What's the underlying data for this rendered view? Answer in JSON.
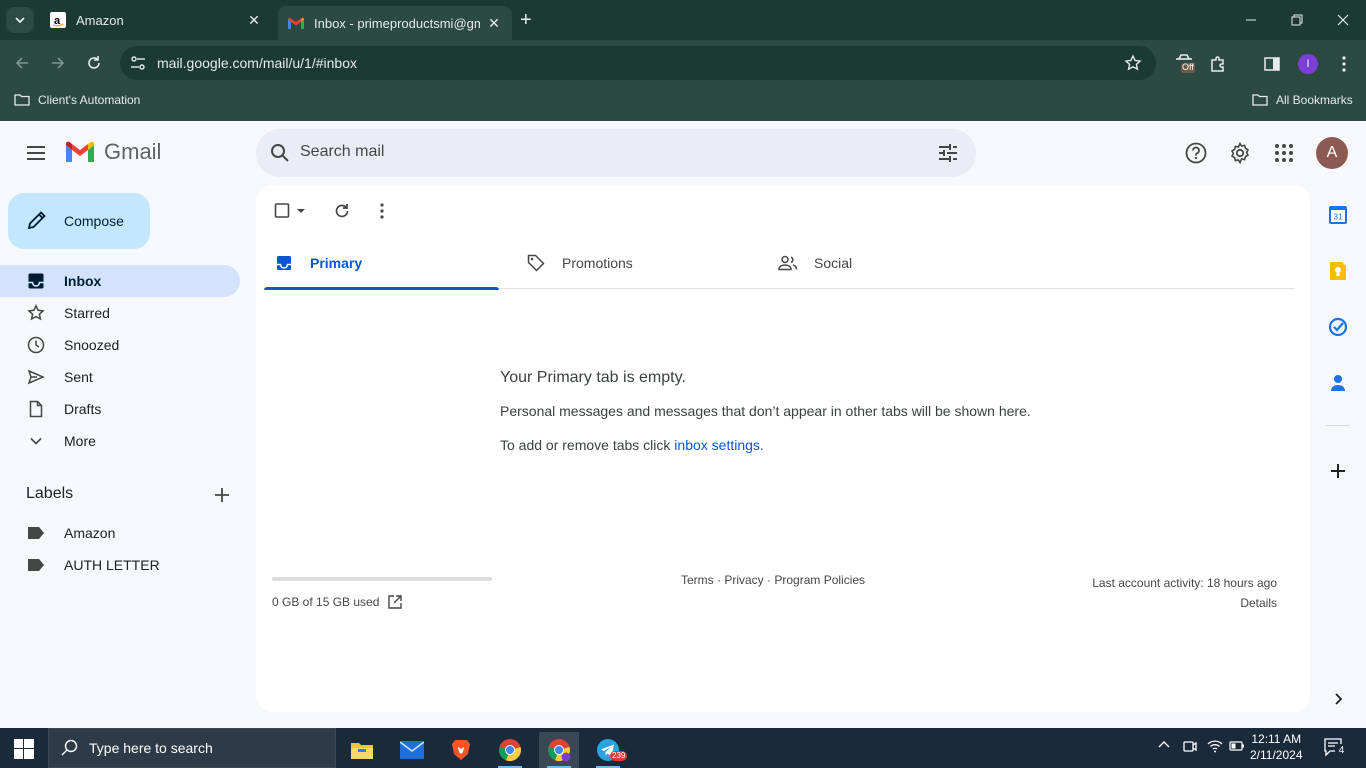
{
  "browser": {
    "tabs": [
      {
        "title": "Amazon",
        "active": false
      },
      {
        "title": "Inbox - primeproductsmi@gma",
        "active": true
      }
    ],
    "url": "mail.google.com/mail/u/1/#inbox",
    "extension_badge": "Off",
    "profile_initial": "I",
    "bookmarks": {
      "folder": "Client's Automation",
      "all": "All Bookmarks"
    }
  },
  "gmail": {
    "logo_text": "Gmail",
    "search_placeholder": "Search mail",
    "avatar_initial": "A",
    "compose_label": "Compose",
    "nav": [
      {
        "label": "Inbox",
        "icon": "inbox-icon",
        "active": true
      },
      {
        "label": "Starred",
        "icon": "star-icon",
        "active": false
      },
      {
        "label": "Snoozed",
        "icon": "clock-icon",
        "active": false
      },
      {
        "label": "Sent",
        "icon": "send-icon",
        "active": false
      },
      {
        "label": "Drafts",
        "icon": "draft-icon",
        "active": false
      },
      {
        "label": "More",
        "icon": "chevron-down-icon",
        "active": false
      }
    ],
    "labels_heading": "Labels",
    "labels": [
      "Amazon",
      "AUTH LETTER"
    ],
    "categories": [
      {
        "label": "Primary",
        "icon": "inbox-icon",
        "active": true
      },
      {
        "label": "Promotions",
        "icon": "tag-icon",
        "active": false
      },
      {
        "label": "Social",
        "icon": "people-icon",
        "active": false
      }
    ],
    "empty": {
      "title": "Your Primary tab is empty.",
      "message": "Personal messages and messages that don’t appear in other tabs will be shown here.",
      "settings_prefix": "To add or remove tabs click ",
      "settings_link": "inbox settings",
      "settings_suffix": "."
    },
    "storage": {
      "text": "0 GB of 15 GB used",
      "fraction_used": 0.0
    },
    "footer": {
      "terms": "Terms",
      "privacy": "Privacy",
      "policies": "Program Policies",
      "sep": " · "
    },
    "activity": {
      "text": "Last account activity: 18 hours ago",
      "details": "Details"
    }
  },
  "taskbar": {
    "search_placeholder": "Type here to search",
    "time": "12:11 AM",
    "date": "2/11/2024",
    "notification_count": "4",
    "telegram_badge": "239"
  },
  "colors": {
    "chrome_dark": "#1b3a32",
    "chrome_toolbar": "#2b4a42",
    "gmail_bg": "#f6f8fc",
    "compose_bg": "#c2e7ff",
    "active_nav": "#d3e3fd",
    "accent_blue": "#0b57d0"
  }
}
